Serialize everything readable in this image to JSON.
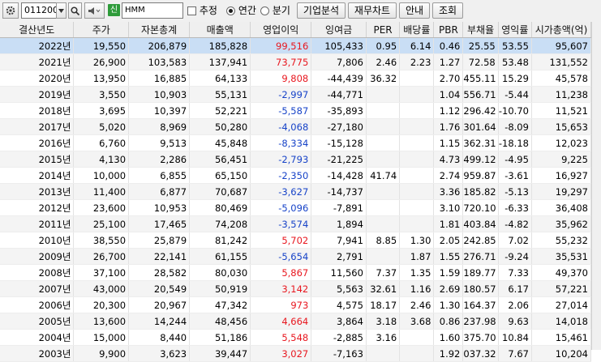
{
  "toolbar": {
    "code": "011200",
    "stock_name": "HMM",
    "stock_badge": "신",
    "estimate_label": "추정",
    "annual_label": "연간",
    "quarter_label": "분기",
    "annual_selected": true,
    "buttons": [
      "기업분석",
      "재무차트",
      "안내",
      "조회"
    ]
  },
  "table": {
    "columns": [
      "결산년도",
      "주가",
      "자본총계",
      "매출액",
      "영업이익",
      "잉여금",
      "PER",
      "배당률",
      "PBR",
      "부채율",
      "영익률",
      "시가총액(억)"
    ],
    "rows": [
      [
        "2022년",
        "19,550",
        "206,879",
        "185,828",
        "99,516",
        "105,433",
        "0.95",
        "6.14",
        "0.46",
        "25.55",
        "53.55",
        "95,607"
      ],
      [
        "2021년",
        "26,900",
        "103,583",
        "137,941",
        "73,775",
        "7,806",
        "2.46",
        "2.23",
        "1.27",
        "72.58",
        "53.48",
        "131,552"
      ],
      [
        "2020년",
        "13,950",
        "16,885",
        "64,133",
        "9,808",
        "-44,439",
        "36.32",
        "",
        "2.70",
        "455.11",
        "15.29",
        "45,578"
      ],
      [
        "2019년",
        "3,550",
        "10,903",
        "55,131",
        "-2,997",
        "-44,771",
        "",
        "",
        "1.04",
        "556.71",
        "-5.44",
        "11,238"
      ],
      [
        "2018년",
        "3,695",
        "10,397",
        "52,221",
        "-5,587",
        "-35,893",
        "",
        "",
        "1.12",
        "296.42",
        "-10.70",
        "11,521"
      ],
      [
        "2017년",
        "5,020",
        "8,969",
        "50,280",
        "-4,068",
        "-27,180",
        "",
        "",
        "1.76",
        "301.64",
        "-8.09",
        "15,653"
      ],
      [
        "2016년",
        "6,760",
        "9,513",
        "45,848",
        "-8,334",
        "-15,128",
        "",
        "",
        "1.15",
        "362.31",
        "-18.18",
        "12,023"
      ],
      [
        "2015년",
        "4,130",
        "2,286",
        "56,451",
        "-2,793",
        "-21,225",
        "",
        "",
        "4.73",
        "499.12",
        "-4.95",
        "9,225"
      ],
      [
        "2014년",
        "10,000",
        "6,855",
        "65,150",
        "-2,350",
        "-14,428",
        "41.74",
        "",
        "2.74",
        "959.87",
        "-3.61",
        "16,927"
      ],
      [
        "2013년",
        "11,400",
        "6,877",
        "70,687",
        "-3,627",
        "-14,737",
        "",
        "",
        "3.36",
        "185.82",
        "-5.13",
        "19,297"
      ],
      [
        "2012년",
        "23,600",
        "10,953",
        "80,469",
        "-5,096",
        "-7,891",
        "",
        "",
        "3.10",
        "720.10",
        "-6.33",
        "36,408"
      ],
      [
        "2011년",
        "25,100",
        "17,465",
        "74,208",
        "-3,574",
        "1,894",
        "",
        "",
        "1.81",
        "403.84",
        "-4.82",
        "35,962"
      ],
      [
        "2010년",
        "38,550",
        "25,879",
        "81,242",
        "5,702",
        "7,941",
        "8.85",
        "1.30",
        "2.05",
        "242.85",
        "7.02",
        "55,232"
      ],
      [
        "2009년",
        "26,700",
        "22,141",
        "61,155",
        "-5,654",
        "2,791",
        "",
        "1.87",
        "1.55",
        "276.71",
        "-9.24",
        "35,531"
      ],
      [
        "2008년",
        "37,100",
        "28,582",
        "80,030",
        "5,867",
        "11,560",
        "7.37",
        "1.35",
        "1.59",
        "189.77",
        "7.33",
        "49,370"
      ],
      [
        "2007년",
        "43,000",
        "20,549",
        "50,919",
        "3,142",
        "5,563",
        "32.61",
        "1.16",
        "2.69",
        "180.57",
        "6.17",
        "57,221"
      ],
      [
        "2006년",
        "20,300",
        "20,967",
        "47,342",
        "973",
        "4,575",
        "18.17",
        "2.46",
        "1.30",
        "164.37",
        "2.06",
        "27,014"
      ],
      [
        "2005년",
        "13,600",
        "14,244",
        "48,456",
        "4,664",
        "3,864",
        "3.18",
        "3.68",
        "0.86",
        "237.98",
        "9.63",
        "14,018"
      ],
      [
        "2004년",
        "15,000",
        "8,440",
        "51,186",
        "5,548",
        "-2,885",
        "3.16",
        "",
        "1.60",
        "375.70",
        "10.84",
        "15,461"
      ],
      [
        "2003년",
        "9,900",
        "3,623",
        "39,447",
        "3,027",
        "-7,163",
        "",
        "",
        "1.92",
        "037.32",
        "7.67",
        "10,204"
      ]
    ]
  },
  "colors": {
    "positive": "#e8171f",
    "negative": "#1743c8",
    "selected_row": "#c9def5"
  },
  "icons": [
    "gear-icon",
    "dropdown-arrow-icon",
    "search-icon",
    "speaker-icon",
    "stock-badge-icon"
  ]
}
